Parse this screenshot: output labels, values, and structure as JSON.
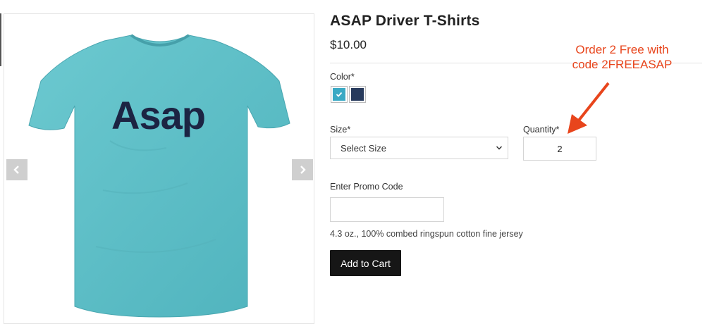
{
  "product": {
    "title": "ASAP Driver T-Shirts",
    "price": "$10.00",
    "image_logo_text": "Asap",
    "description": "4.3 oz., 100% combed ringspun cotton fine jersey"
  },
  "colors": {
    "label": "Color*",
    "options": [
      {
        "name": "teal",
        "hex": "#3aa9c4",
        "selected": true
      },
      {
        "name": "navy",
        "hex": "#273a5c",
        "selected": false
      }
    ]
  },
  "size": {
    "label": "Size*",
    "selected": "Select Size"
  },
  "quantity": {
    "label": "Quantity*",
    "value": "2"
  },
  "promo": {
    "label": "Enter Promo Code",
    "value": ""
  },
  "actions": {
    "add_to_cart": "Add to Cart"
  },
  "annotation": {
    "line1": "Order 2 Free with",
    "line2": "code 2FREEASAP",
    "color": "#e8451c"
  },
  "gallery": {
    "prev_icon": "chevron-left-icon",
    "next_icon": "chevron-right-icon",
    "shirt_color": "#5fc0c8",
    "logo_color": "#1c2443"
  }
}
